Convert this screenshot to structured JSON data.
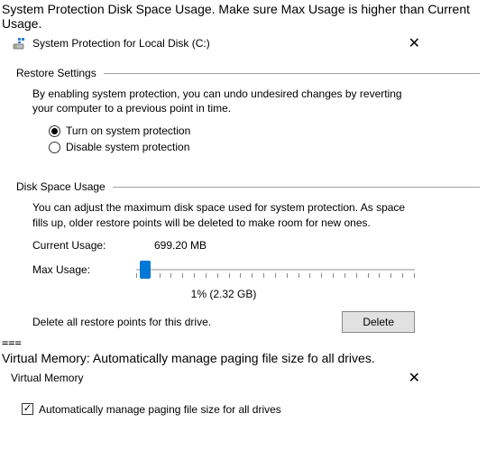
{
  "header_instruction": "System Protection Disk Space Usage. Make sure Max Usage is higher than Current Usage.",
  "protection": {
    "window_title": "System Protection for Local Disk (C:)",
    "restore_header": "Restore Settings",
    "restore_desc": "By enabling system protection, you can undo undesired changes by reverting your computer to a previous point in time.",
    "radio_on": "Turn on system protection",
    "radio_off": "Disable system protection",
    "disk_header": "Disk Space Usage",
    "disk_desc": "You can adjust the maximum disk space used for system protection. As space fills up, older restore points will be deleted to make room for new ones.",
    "current_usage_label": "Current Usage:",
    "current_usage_value": "699.20 MB",
    "max_usage_label": "Max Usage:",
    "max_usage_value": "1% (2.32 GB)",
    "delete_desc": "Delete all restore points for this drive.",
    "delete_button": "Delete"
  },
  "separator": "===",
  "vm": {
    "header_instruction": "Virtual Memory: Automatically manage paging file size fo all drives.",
    "window_title": "Virtual Memory",
    "auto_checkbox": "Automatically manage paging file size for all drives"
  }
}
